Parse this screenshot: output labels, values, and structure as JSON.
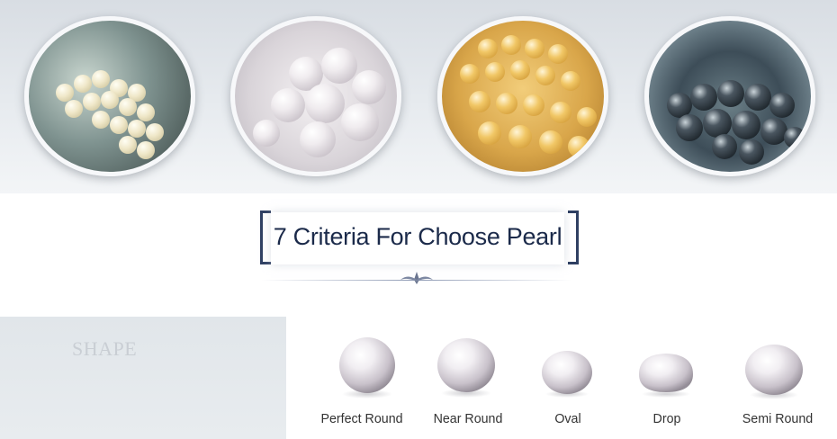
{
  "gallery": {
    "images": [
      {
        "name": "akoya-pearls-in-shell",
        "pearl_color": "#efe7c8"
      },
      {
        "name": "white-pearls-in-shell",
        "pearl_color": "#f0ecef"
      },
      {
        "name": "golden-pearls",
        "pearl_color": "#f1c766"
      },
      {
        "name": "tahitian-black-pearls",
        "pearl_color": "#1d252b"
      }
    ]
  },
  "heading": {
    "title": "7 Criteria For Choose Pearl",
    "bracket_color": "#2e3f62",
    "text_color": "#1b2a4a"
  },
  "shape_section": {
    "label": "SHAPE",
    "shapes": [
      {
        "caption": "Perfect Round"
      },
      {
        "caption": "Near Round"
      },
      {
        "caption": "Oval"
      },
      {
        "caption": "Drop"
      },
      {
        "caption": "Semi Round"
      }
    ]
  }
}
